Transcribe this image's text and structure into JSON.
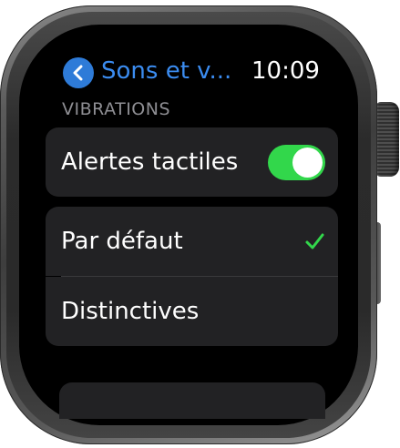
{
  "nav": {
    "back_title": "Sons et v...",
    "time": "10:09"
  },
  "section": {
    "header": "VIBRATIONS"
  },
  "haptic_alerts": {
    "label": "Alertes tactiles",
    "enabled": true
  },
  "options": [
    {
      "label": "Par défaut",
      "selected": true
    },
    {
      "label": "Distinctives",
      "selected": false
    }
  ],
  "colors": {
    "accent_blue": "#3b8cf0",
    "toggle_on": "#32d74b",
    "checkmark": "#32d74b",
    "cell_background": "#222224",
    "section_header": "#8e8e93"
  }
}
